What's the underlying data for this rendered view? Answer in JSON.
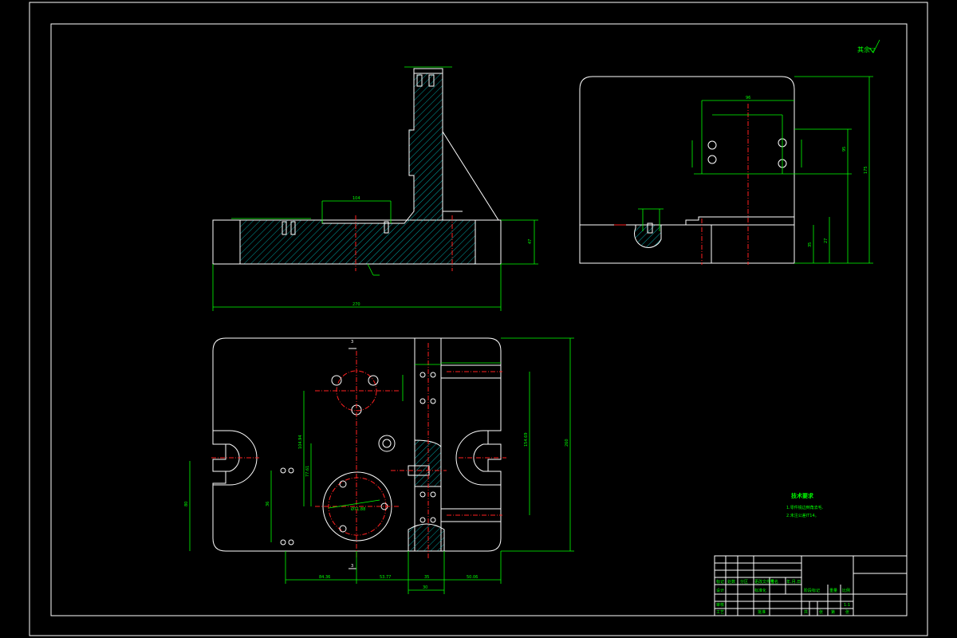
{
  "roughness_note": "其余▽",
  "tech_req": {
    "title": "技术要求",
    "line1": "1.零件锐边倒角去毛.",
    "line2": "2.未注公差IT14。"
  },
  "dims": {
    "front_overall_width": "270",
    "front_height": "47",
    "front_slot": "104",
    "top_overall_height": "260",
    "top_width": "80",
    "top_right": "154.69",
    "top_left_1": "104.94",
    "top_left_2": "77.61",
    "bottom_1": "84.36",
    "bottom_2": "53.77",
    "bottom_3": "35",
    "bottom_4": "50.06",
    "bottom_5": "30",
    "left_small": "36",
    "left_slot": "80",
    "circle_dia": "Ø71.88",
    "side_width": "96",
    "side_height": "175",
    "side_mid": "95",
    "side_small": "27",
    "side_bottom": "35",
    "section_mark": "3"
  },
  "title_block": {
    "labels": [
      "设计",
      "标准化",
      "标记",
      "处数",
      "分区",
      "更改文件号",
      "签名",
      "年.月.日",
      "审核",
      "工艺",
      "批准",
      "阶段标记",
      "重量",
      "比例",
      "共",
      "张",
      "第",
      "张"
    ],
    "material": "",
    "scale": "1:1"
  },
  "colors": {
    "background": "#000000",
    "outline": "#ffffff",
    "dimension": "#00ff00",
    "centerline": "#ff2020"
  }
}
